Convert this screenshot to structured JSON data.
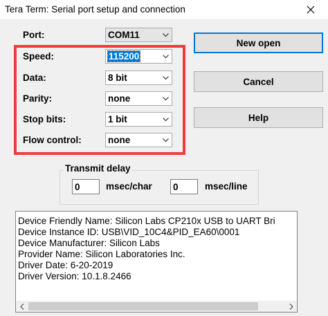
{
  "window": {
    "title": "Tera Term: Serial port setup and connection",
    "close_icon": "close-icon"
  },
  "form": {
    "port": {
      "label": "Port:",
      "value": "COM11"
    },
    "speed": {
      "label": "Speed:",
      "value": "115200"
    },
    "data": {
      "label": "Data:",
      "value": "8 bit"
    },
    "parity": {
      "label": "Parity:",
      "value": "none"
    },
    "stop_bits": {
      "label": "Stop bits:",
      "value": "1 bit"
    },
    "flow_control": {
      "label": "Flow control:",
      "value": "none"
    }
  },
  "buttons": {
    "new_open": "New open",
    "cancel": "Cancel",
    "help": "Help"
  },
  "transmit_delay": {
    "title": "Transmit delay",
    "char_value": "0",
    "char_unit": "msec/char",
    "line_value": "0",
    "line_unit": "msec/line"
  },
  "device_info": {
    "lines": [
      "Device Friendly Name: Silicon Labs CP210x USB to UART Bri",
      "Device Instance ID: USB\\VID_10C4&PID_EA60\\0001",
      "Device Manufacturer: Silicon Labs",
      "Provider Name: Silicon Laboratories Inc.",
      "Driver Date: 6-20-2019",
      "Driver Version: 10.1.8.2466"
    ]
  },
  "colors": {
    "highlight": "#f03c3c",
    "accent": "#0078d7"
  }
}
